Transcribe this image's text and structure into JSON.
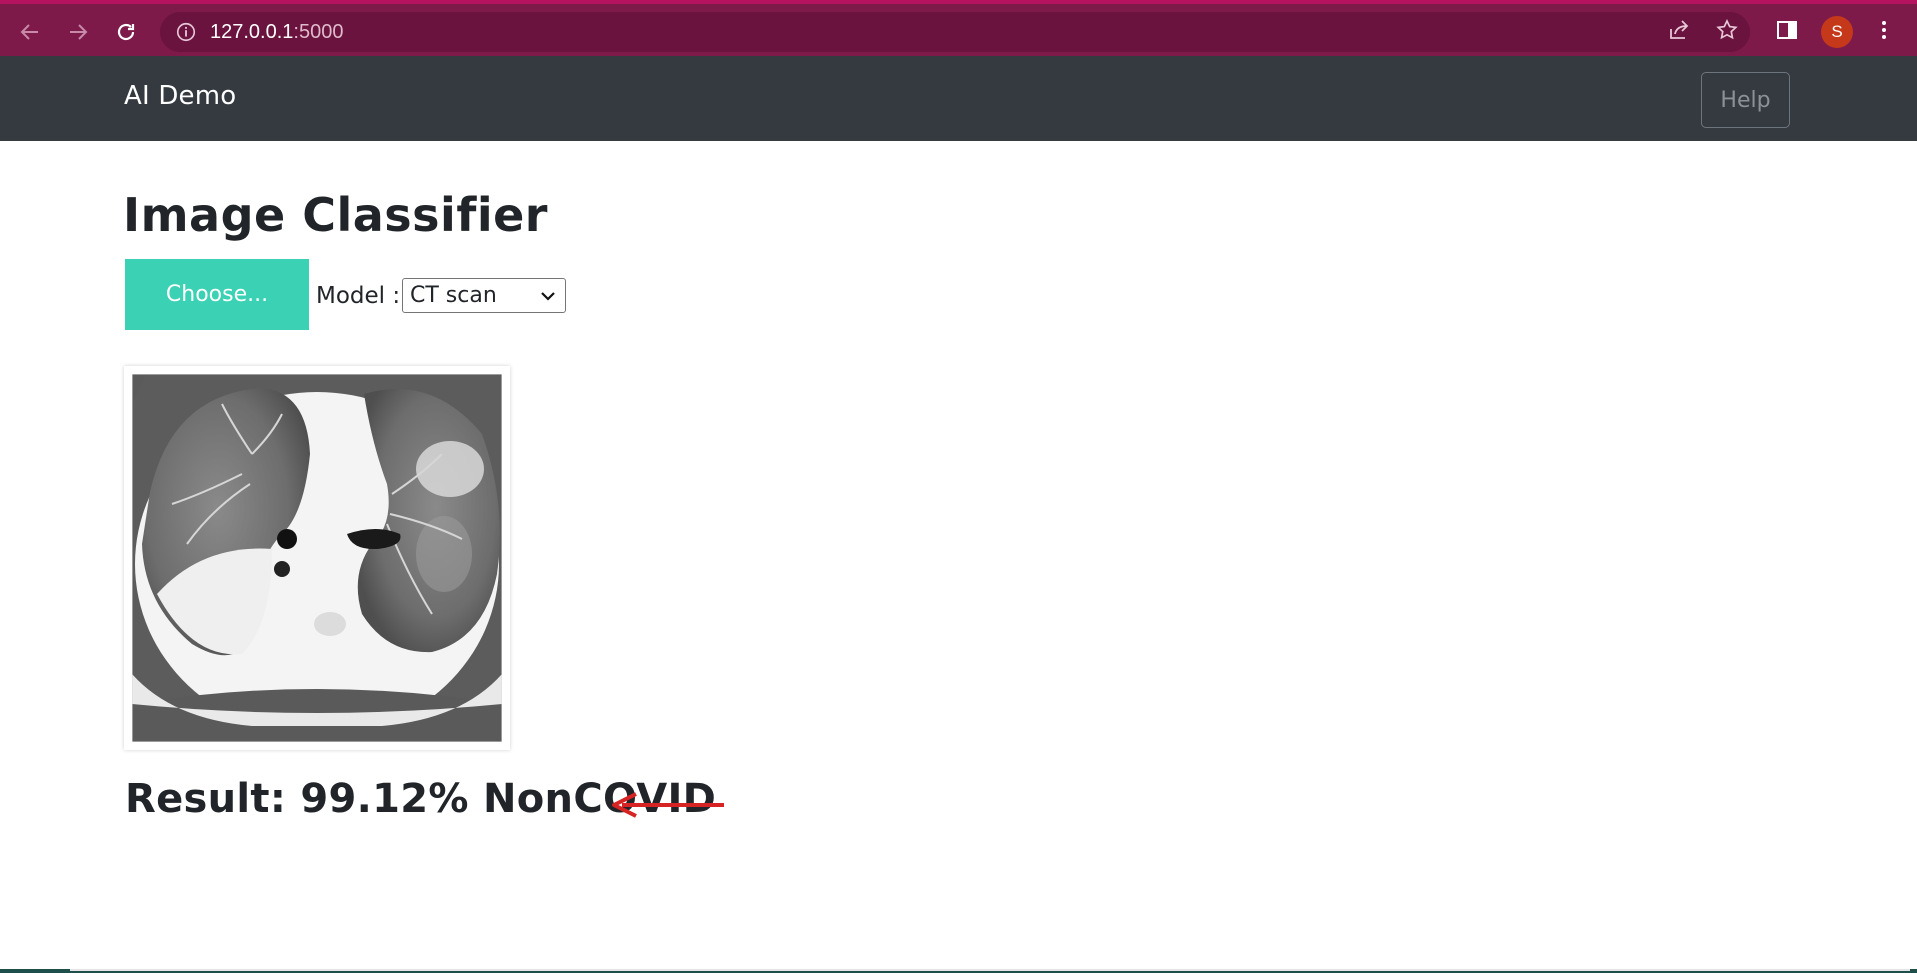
{
  "browser": {
    "url_host": "127.0.0.1",
    "url_port": ":5000",
    "profile_initial": "S",
    "accent": "#7d1a4a"
  },
  "navbar": {
    "brand": "AI Demo",
    "help_label": "Help"
  },
  "main": {
    "title": "Image Classifier",
    "choose_label": "Choose...",
    "model_label": "Model :",
    "model_selected": "CT scan",
    "result_text": "Result: 99.12% NonCOVID",
    "accent_color": "#3ad1b4",
    "arrow_color": "#d62424"
  }
}
